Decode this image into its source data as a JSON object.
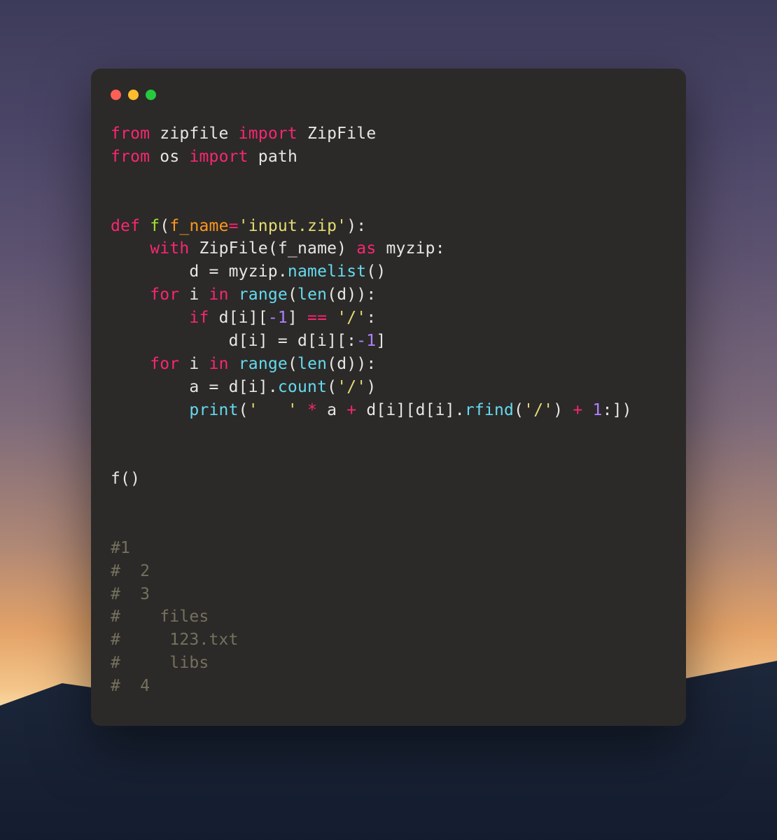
{
  "code": {
    "l1_from": "from",
    "l1_mod": "zipfile",
    "l1_import": "import",
    "l1_cls": "ZipFile",
    "l2_from": "from",
    "l2_mod": "os",
    "l2_import": "import",
    "l2_cls": "path",
    "blank1": "",
    "blank2": "",
    "l5_def": "def",
    "l5_fn": "f",
    "l5_open": "(",
    "l5_param": "f_name",
    "l5_eq": "=",
    "l5_str": "'input.zip'",
    "l5_close": "):",
    "l6_indent": "    ",
    "l6_with": "with",
    "l6_cls": "ZipFile",
    "l6_open": "(",
    "l6_arg": "f_name",
    "l6_close": ")",
    "l6_as": "as",
    "l6_var": "myzip",
    "l6_colon": ":",
    "l7_indent": "        ",
    "l7_var": "d",
    "l7_eq": " = ",
    "l7_obj": "myzip",
    "l7_dot": ".",
    "l7_method": "namelist",
    "l7_call": "()",
    "l8_indent": "    ",
    "l8_for": "for",
    "l8_i": "i",
    "l8_in": "in",
    "l8_range": "range",
    "l8_open": "(",
    "l8_len": "len",
    "l8_open2": "(",
    "l8_d": "d",
    "l8_close": ")):",
    "l9_indent": "        ",
    "l9_if": "if",
    "l9_di": "d[i][",
    "l9_neg1": "-1",
    "l9_br": "]",
    "l9_eq": " == ",
    "l9_slash": "'/'",
    "l9_colon": ":",
    "l10_indent": "            ",
    "l10_lhs": "d[i]",
    "l10_eq": " = ",
    "l10_rhs1": "d[i][:",
    "l10_neg1": "-1",
    "l10_rhs2": "]",
    "l11_indent": "    ",
    "l11_for": "for",
    "l11_i": "i",
    "l11_in": "in",
    "l11_range": "range",
    "l11_open": "(",
    "l11_len": "len",
    "l11_open2": "(",
    "l11_d": "d",
    "l11_close": ")):",
    "l12_indent": "        ",
    "l12_a": "a",
    "l12_eq": " = ",
    "l12_di": "d[i]",
    "l12_dot": ".",
    "l12_count": "count",
    "l12_open": "(",
    "l12_slash": "'/'",
    "l12_close": ")",
    "l13_indent": "        ",
    "l13_print": "print",
    "l13_open": "(",
    "l13_str": "'   '",
    "l13_mul": " * ",
    "l13_a": "a",
    "l13_plus": " + ",
    "l13_di": "d[i][d[i]",
    "l13_dot": ".",
    "l13_rfind": "rfind",
    "l13_open2": "(",
    "l13_slash": "'/'",
    "l13_close2": ")",
    "l13_plus2": " + ",
    "l13_one": "1",
    "l13_close3": ":])",
    "blank3": "",
    "blank4": "",
    "l16": "f()",
    "blank5": "",
    "blank6": "",
    "c1": "#1",
    "c2": "#  2",
    "c3": "#  3",
    "c4": "#    files",
    "c5": "#     123.txt",
    "c6": "#     libs",
    "c7": "#  4"
  }
}
